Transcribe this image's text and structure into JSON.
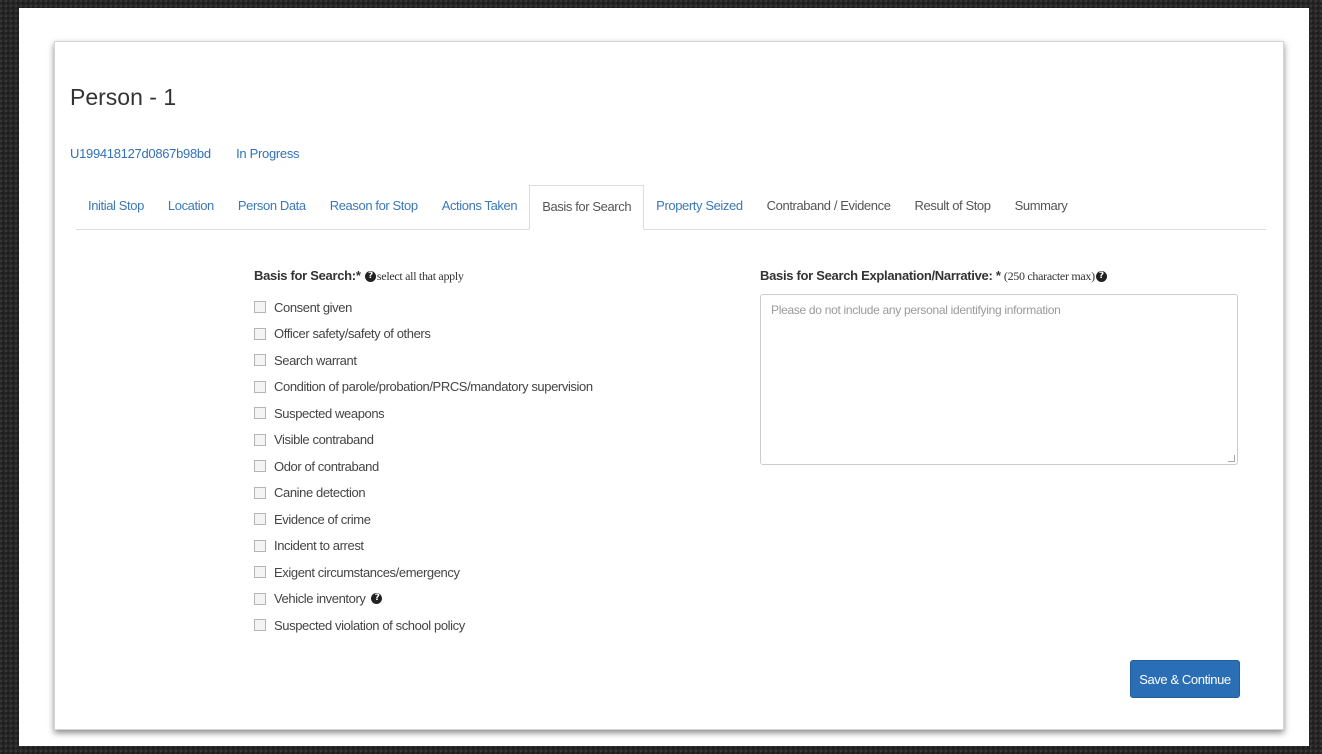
{
  "page": {
    "title": "Person - 1",
    "record_id": "U199418127d0867b98bd",
    "status": "In Progress"
  },
  "tabs": [
    {
      "label": "Initial Stop"
    },
    {
      "label": "Location"
    },
    {
      "label": "Person Data"
    },
    {
      "label": "Reason for Stop"
    },
    {
      "label": "Actions Taken"
    },
    {
      "label": "Basis for Search",
      "active": true
    },
    {
      "label": "Property Seized"
    },
    {
      "label": "Contraband / Evidence"
    },
    {
      "label": "Result of Stop"
    },
    {
      "label": "Summary"
    }
  ],
  "basis_for_search": {
    "label": "Basis for Search:",
    "required_mark": "*",
    "hint": "select all that apply",
    "options": [
      {
        "label": "Consent given",
        "checked": false
      },
      {
        "label": "Officer safety/safety of others",
        "checked": false
      },
      {
        "label": "Search warrant",
        "checked": false
      },
      {
        "label": "Condition of parole/probation/PRCS/mandatory supervision",
        "checked": false
      },
      {
        "label": "Suspected weapons",
        "checked": false
      },
      {
        "label": "Visible contraband",
        "checked": false
      },
      {
        "label": "Odor of contraband",
        "checked": false
      },
      {
        "label": "Canine detection",
        "checked": false
      },
      {
        "label": "Evidence of crime",
        "checked": false
      },
      {
        "label": "Incident to arrest",
        "checked": false
      },
      {
        "label": "Exigent circumstances/emergency",
        "checked": false
      },
      {
        "label": "Vehicle inventory",
        "checked": false
      },
      {
        "label": "Suspected violation of school policy",
        "checked": false
      }
    ]
  },
  "narrative": {
    "label": "Basis for Search Explanation/Narrative:",
    "required_mark": "*",
    "hint": "(250 character max)",
    "placeholder": "Please do not include any personal identifying information",
    "value": ""
  },
  "actions": {
    "save_label": "Save & Continue"
  },
  "colors": {
    "link": "#3172b6",
    "primary_button": "#2a6eb5",
    "background": "#262626"
  },
  "icons": {
    "help": "question-circle-icon"
  }
}
